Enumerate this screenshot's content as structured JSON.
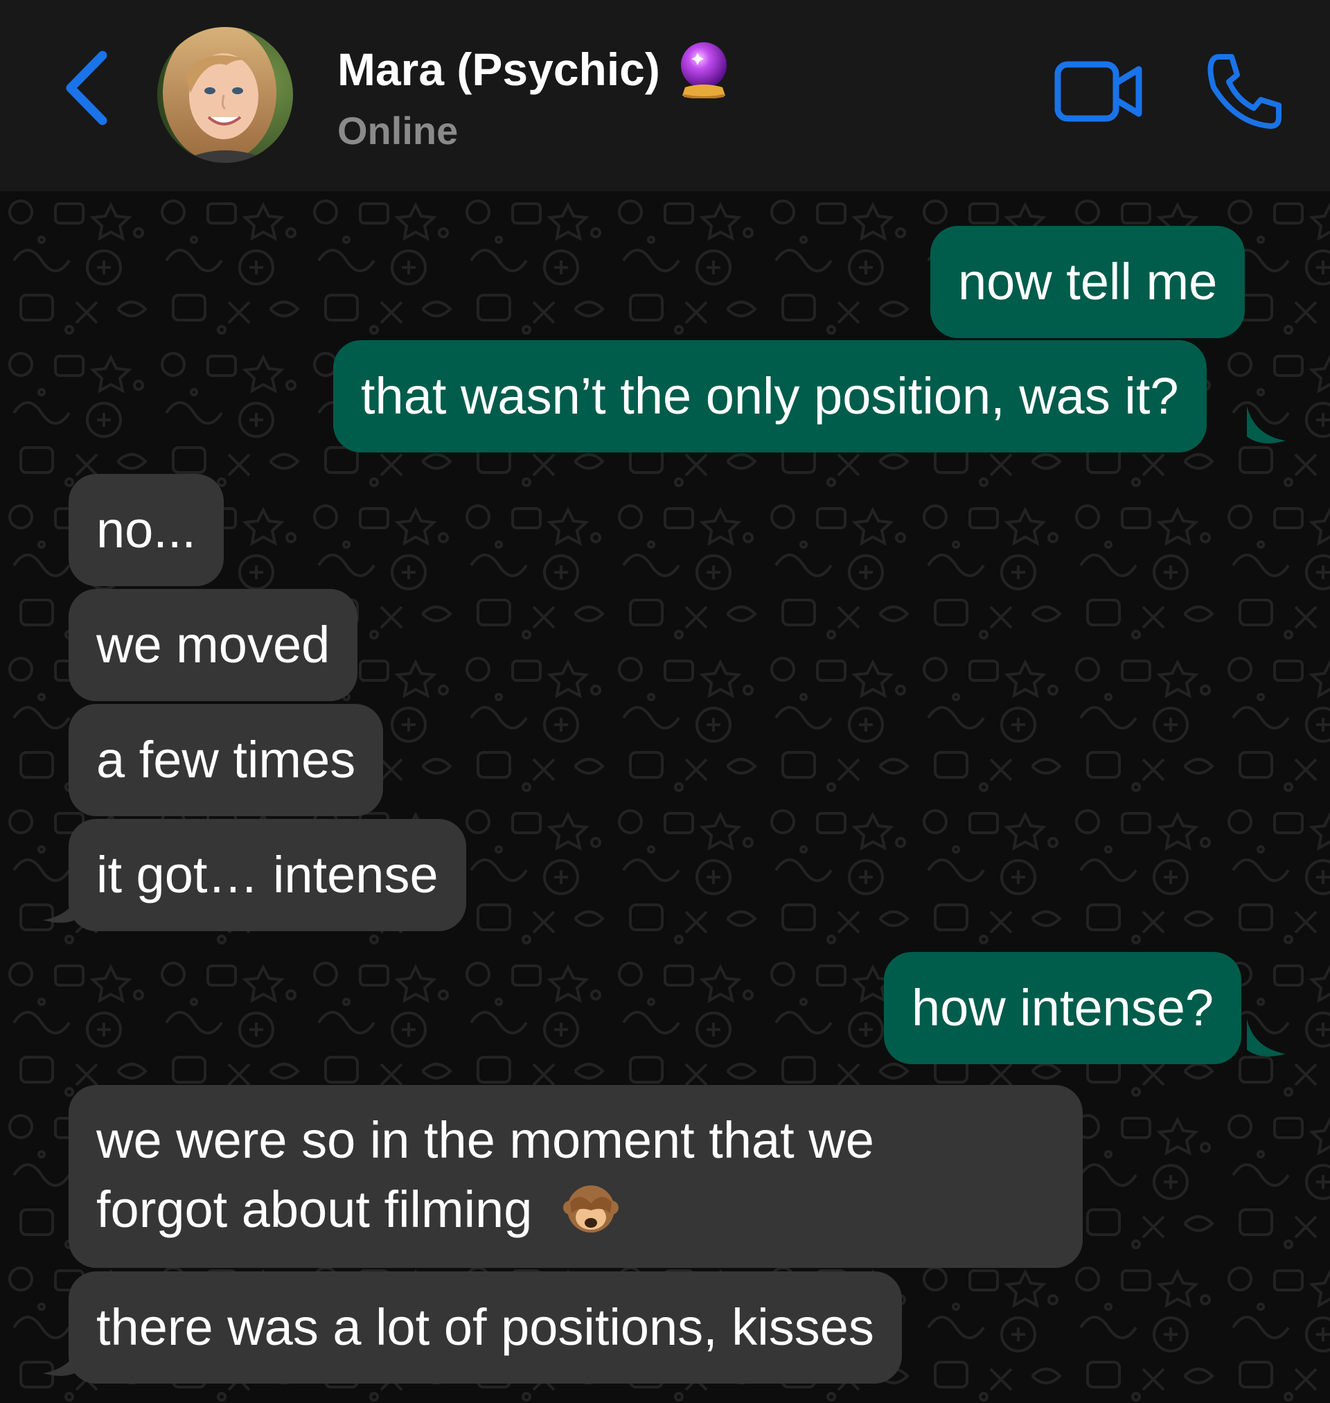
{
  "header": {
    "contact_name": "Mara (Psychic)",
    "status": "Online",
    "icons": {
      "back": "chevron-left-icon",
      "name_emoji": "crystal-ball-icon",
      "video": "video-camera-icon",
      "call": "phone-icon"
    }
  },
  "messages": [
    {
      "direction": "outgoing",
      "text": "now tell me"
    },
    {
      "direction": "outgoing",
      "text": "that wasn’t the only position, was it?"
    },
    {
      "direction": "incoming",
      "text": "no..."
    },
    {
      "direction": "incoming",
      "text": "we moved"
    },
    {
      "direction": "incoming",
      "text": "a few times"
    },
    {
      "direction": "incoming",
      "text": "it got… intense"
    },
    {
      "direction": "outgoing",
      "text": "how intense?"
    },
    {
      "direction": "incoming",
      "text_line1": "we were so in the moment that we",
      "text_line2": "forgot about filming",
      "emoji": "see-no-evil-monkey-icon"
    },
    {
      "direction": "incoming",
      "text": "there was a lot of positions, kisses"
    }
  ],
  "colors": {
    "accent": "#1a73e8",
    "outgoing_bubble": "#005c4b",
    "incoming_bubble": "#363636",
    "header_bg": "#181818",
    "status_text": "#8a8a8a"
  }
}
